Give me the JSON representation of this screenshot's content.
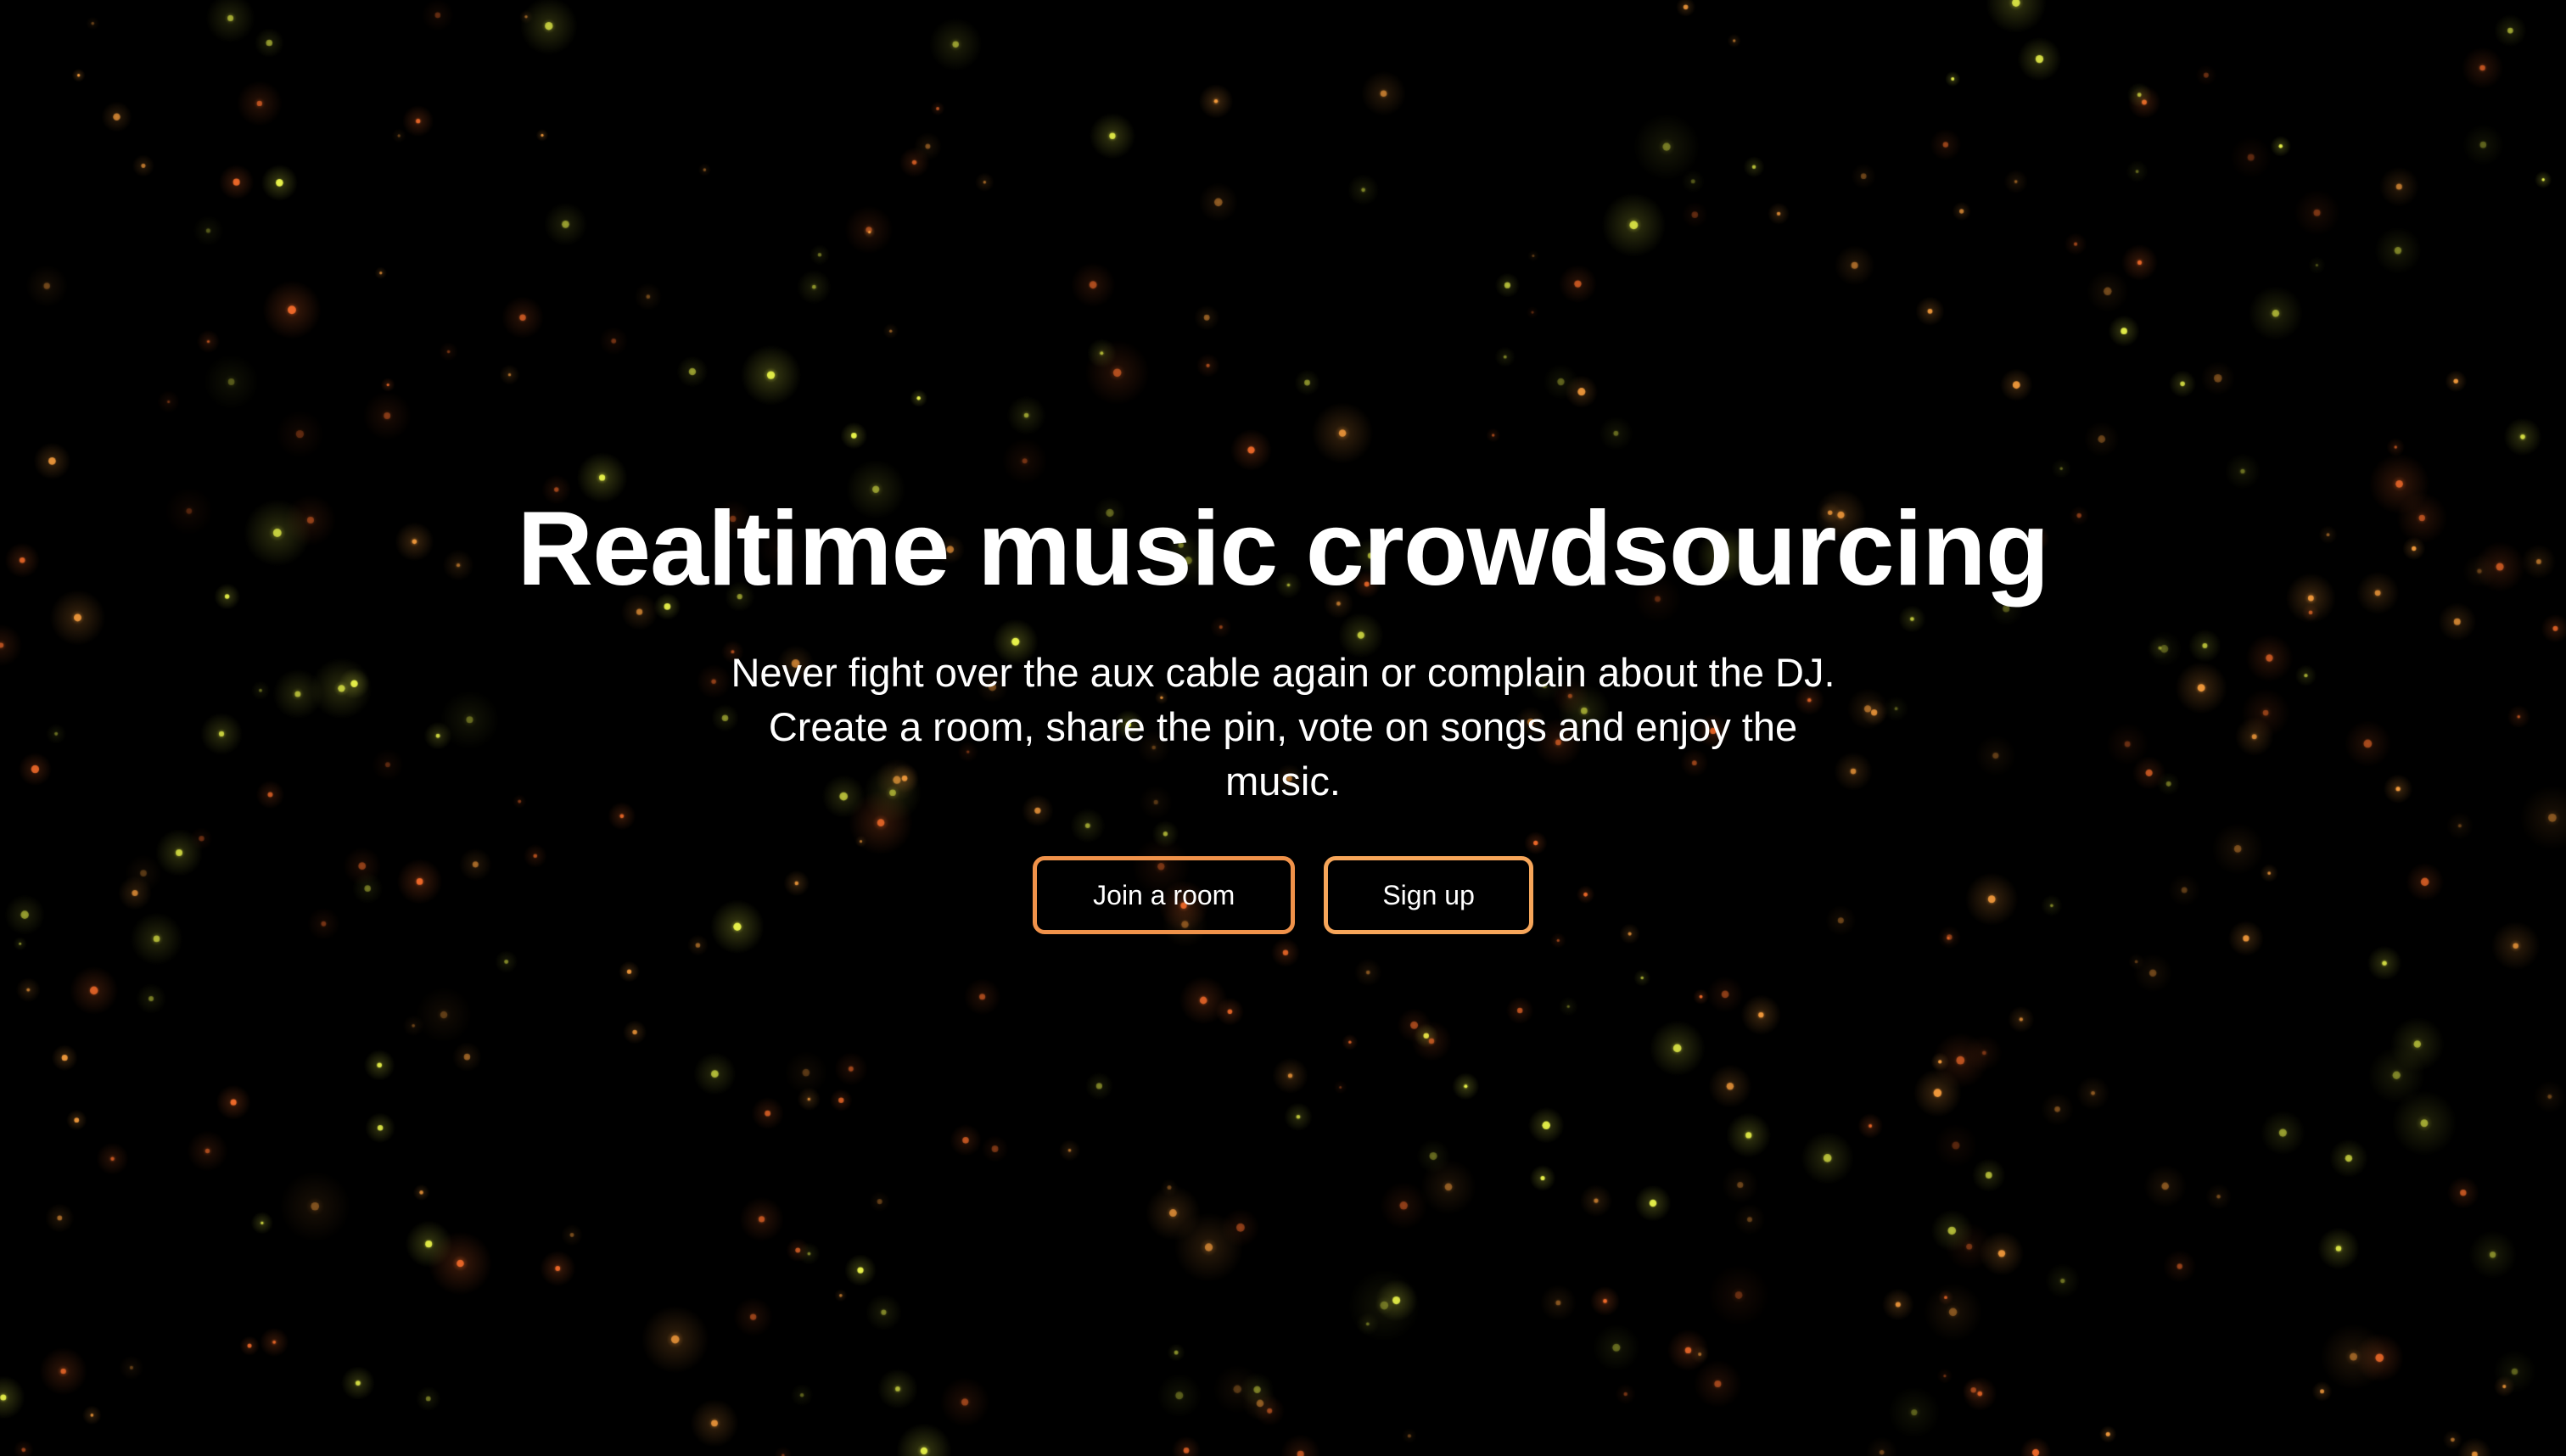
{
  "hero": {
    "title": "Realtime music crowdsourcing",
    "subtitle": "Never fight over the aux cable again or complain about the DJ. Create a room, share the pin, vote on songs and enjoy the music."
  },
  "actions": {
    "join_label": "Join a room",
    "signup_label": "Sign up"
  },
  "theme": {
    "background": "#000000",
    "text": "#ffffff",
    "button_border_accent": "#f0924a",
    "particle_colors": [
      "#e8f24a",
      "#f29a3c",
      "#f06a2a"
    ]
  },
  "background": {
    "type": "glowing-particle-field"
  }
}
